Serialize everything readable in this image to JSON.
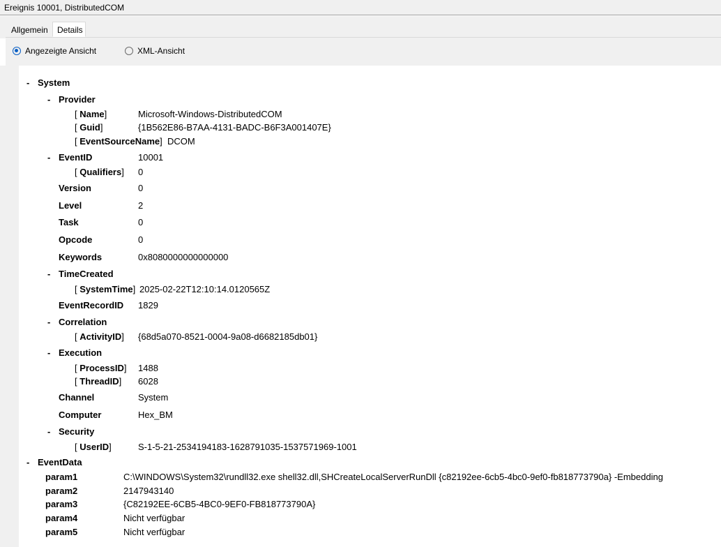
{
  "window": {
    "title": "Ereignis 10001, DistributedCOM"
  },
  "tabs": [
    {
      "label": "Allgemein",
      "active": false
    },
    {
      "label": "Details",
      "active": true
    }
  ],
  "view_options": [
    {
      "label": "Angezeigte Ansicht",
      "selected": true
    },
    {
      "label": "XML-Ansicht",
      "selected": false
    }
  ],
  "collapse_symbol": "-",
  "attr_open": "[",
  "attr_close": "]",
  "tree": {
    "system": {
      "label": "System",
      "provider": {
        "label": "Provider",
        "name": {
          "key": "Name",
          "value": "Microsoft-Windows-DistributedCOM"
        },
        "guid": {
          "key": "Guid",
          "value": "{1B562E86-B7AA-4131-BADC-B6F3A001407E}"
        },
        "event_source_name": {
          "key": "EventSourceName",
          "value": "DCOM"
        }
      },
      "event_id": {
        "label": "EventID",
        "value": "10001",
        "qualifiers": {
          "key": "Qualifiers",
          "value": "0"
        }
      },
      "version": {
        "label": "Version",
        "value": "0"
      },
      "level": {
        "label": "Level",
        "value": "2"
      },
      "task": {
        "label": "Task",
        "value": "0"
      },
      "opcode": {
        "label": "Opcode",
        "value": "0"
      },
      "keywords": {
        "label": "Keywords",
        "value": "0x8080000000000000"
      },
      "time_created": {
        "label": "TimeCreated",
        "system_time": {
          "key": "SystemTime",
          "value": "2025-02-22T12:10:14.0120565Z"
        }
      },
      "event_record_id": {
        "label": "EventRecordID",
        "value": "1829"
      },
      "correlation": {
        "label": "Correlation",
        "activity_id": {
          "key": "ActivityID",
          "value": "{68d5a070-8521-0004-9a08-d6682185db01}"
        }
      },
      "execution": {
        "label": "Execution",
        "process_id": {
          "key": "ProcessID",
          "value": "1488"
        },
        "thread_id": {
          "key": "ThreadID",
          "value": "6028"
        }
      },
      "channel": {
        "label": "Channel",
        "value": "System"
      },
      "computer": {
        "label": "Computer",
        "value": "Hex_BM"
      },
      "security": {
        "label": "Security",
        "user_id": {
          "key": "UserID",
          "value": "S-1-5-21-2534194183-1628791035-1537571969-1001"
        }
      }
    },
    "event_data": {
      "label": "EventData",
      "params": [
        {
          "key": "param1",
          "value": "C:\\WINDOWS\\System32\\rundll32.exe shell32.dll,SHCreateLocalServerRunDll {c82192ee-6cb5-4bc0-9ef0-fb818773790a} -Embedding"
        },
        {
          "key": "param2",
          "value": "2147943140"
        },
        {
          "key": "param3",
          "value": "{C82192EE-6CB5-4BC0-9EF0-FB818773790A}"
        },
        {
          "key": "param4",
          "value": "Nicht verfügbar"
        },
        {
          "key": "param5",
          "value": "Nicht verfügbar"
        }
      ]
    }
  }
}
